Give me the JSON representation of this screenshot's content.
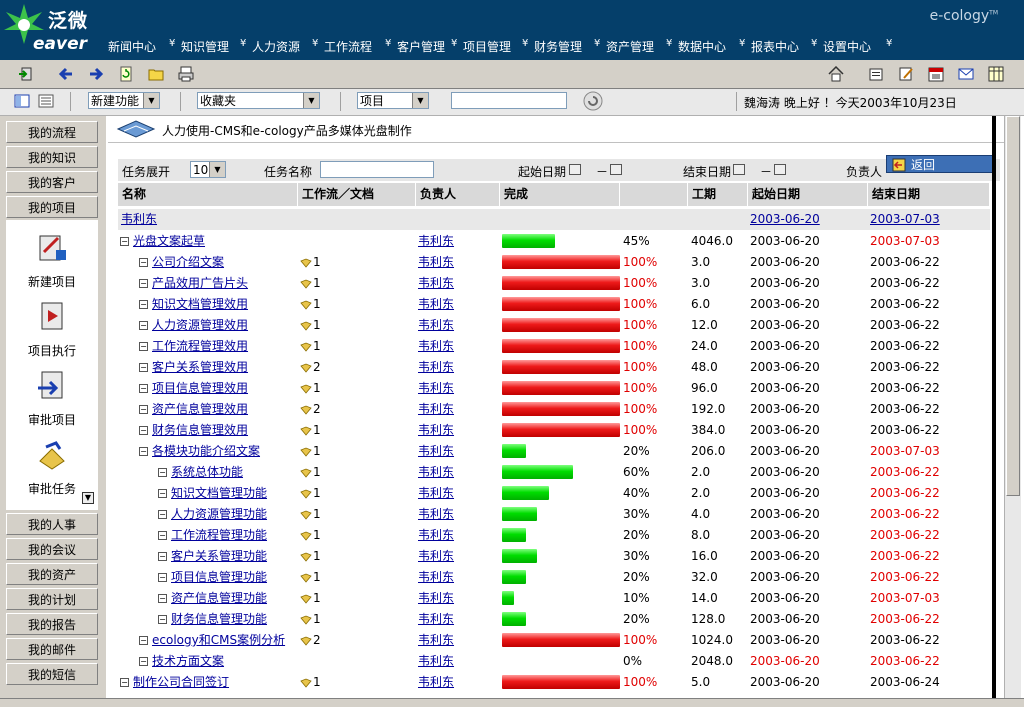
{
  "brand": {
    "logo_cn": "泛微",
    "logo_en": "eaver",
    "product": "e-cology",
    "tm": "TM"
  },
  "nav": [
    "新闻中心",
    "知识管理",
    "人力资源",
    "工作流程",
    "客户管理",
    "项目管理",
    "财务管理",
    "资产管理",
    "数据中心",
    "报表中心",
    "设置中心"
  ],
  "quickbar": {
    "new_function": "新建功能",
    "favorites": "收藏夹",
    "scope": "项目",
    "search_value": "",
    "greeting": "魏海涛 晚上好 ！今天2003年10月23日"
  },
  "sidebar": {
    "top": [
      "我的流程",
      "我的知识",
      "我的客户",
      "我的项目"
    ],
    "panel": [
      "新建项目",
      "项目执行",
      "审批项目",
      "审批任务"
    ],
    "bottom": [
      "我的人事",
      "我的会议",
      "我的资产",
      "我的计划",
      "我的报告",
      "我的邮件",
      "我的短信"
    ]
  },
  "page": {
    "title": "人力使用-CMS和e-cology产品多媒体光盘制作",
    "filter": {
      "expand_label": "任务展开",
      "expand_value": "10",
      "name_label": "任务名称",
      "start_label": "起始日期",
      "dash": "－",
      "end_label": "结束日期",
      "owner_label": "负责人",
      "return_label": "返回"
    },
    "headers": [
      "名称",
      "工作流／文档",
      "负责人",
      "完成",
      "",
      "工期",
      "起始日期",
      "结束日期"
    ]
  },
  "colors": {
    "nav_bg": "#053f6a",
    "link": "#00009c",
    "overdue": "#e00000",
    "bar_done": "#ee1a1a",
    "bar_progress": "#00dd00"
  },
  "group_row": {
    "name": "韦利东",
    "start": "2003-06-20",
    "end": "2003-07-03"
  },
  "rows": [
    {
      "level": 0,
      "name": "光盘文案起草",
      "docs": "",
      "owner": "韦利东",
      "pct": 45,
      "pct_label": "45%",
      "duration": "4046.0",
      "start": "2003-06-20",
      "end": "2003-07-03",
      "end_red": true,
      "start_red": false
    },
    {
      "level": 1,
      "name": "公司介绍文案",
      "docs": "1",
      "owner": "韦利东",
      "pct": 100,
      "pct_label": "100%",
      "duration": "3.0",
      "start": "2003-06-20",
      "end": "2003-06-22",
      "end_red": false,
      "start_red": false
    },
    {
      "level": 1,
      "name": "产品效用广告片头",
      "docs": "1",
      "owner": "韦利东",
      "pct": 100,
      "pct_label": "100%",
      "duration": "3.0",
      "start": "2003-06-20",
      "end": "2003-06-22",
      "end_red": false,
      "start_red": false
    },
    {
      "level": 1,
      "name": "知识文档管理效用",
      "docs": "1",
      "owner": "韦利东",
      "pct": 100,
      "pct_label": "100%",
      "duration": "6.0",
      "start": "2003-06-20",
      "end": "2003-06-22",
      "end_red": false,
      "start_red": false
    },
    {
      "level": 1,
      "name": "人力资源管理效用",
      "docs": "1",
      "owner": "韦利东",
      "pct": 100,
      "pct_label": "100%",
      "duration": "12.0",
      "start": "2003-06-20",
      "end": "2003-06-22",
      "end_red": false,
      "start_red": false
    },
    {
      "level": 1,
      "name": "工作流程管理效用",
      "docs": "1",
      "owner": "韦利东",
      "pct": 100,
      "pct_label": "100%",
      "duration": "24.0",
      "start": "2003-06-20",
      "end": "2003-06-22",
      "end_red": false,
      "start_red": false
    },
    {
      "level": 1,
      "name": "客户关系管理效用",
      "docs": "2",
      "owner": "韦利东",
      "pct": 100,
      "pct_label": "100%",
      "duration": "48.0",
      "start": "2003-06-20",
      "end": "2003-06-22",
      "end_red": false,
      "start_red": false
    },
    {
      "level": 1,
      "name": "项目信息管理效用",
      "docs": "1",
      "owner": "韦利东",
      "pct": 100,
      "pct_label": "100%",
      "duration": "96.0",
      "start": "2003-06-20",
      "end": "2003-06-22",
      "end_red": false,
      "start_red": false
    },
    {
      "level": 1,
      "name": "资产信息管理效用",
      "docs": "2",
      "owner": "韦利东",
      "pct": 100,
      "pct_label": "100%",
      "duration": "192.0",
      "start": "2003-06-20",
      "end": "2003-06-22",
      "end_red": false,
      "start_red": false
    },
    {
      "level": 1,
      "name": "财务信息管理效用",
      "docs": "1",
      "owner": "韦利东",
      "pct": 100,
      "pct_label": "100%",
      "duration": "384.0",
      "start": "2003-06-20",
      "end": "2003-06-22",
      "end_red": false,
      "start_red": false
    },
    {
      "level": 1,
      "name": "各模块功能介绍文案",
      "docs": "1",
      "owner": "韦利东",
      "pct": 20,
      "pct_label": "20%",
      "duration": "206.0",
      "start": "2003-06-20",
      "end": "2003-07-03",
      "end_red": true,
      "start_red": false
    },
    {
      "level": 2,
      "name": "系统总体功能",
      "docs": "1",
      "owner": "韦利东",
      "pct": 60,
      "pct_label": "60%",
      "duration": "2.0",
      "start": "2003-06-20",
      "end": "2003-06-22",
      "end_red": true,
      "start_red": false
    },
    {
      "level": 2,
      "name": "知识文档管理功能",
      "docs": "1",
      "owner": "韦利东",
      "pct": 40,
      "pct_label": "40%",
      "duration": "2.0",
      "start": "2003-06-20",
      "end": "2003-06-22",
      "end_red": true,
      "start_red": false
    },
    {
      "level": 2,
      "name": "人力资源管理功能",
      "docs": "1",
      "owner": "韦利东",
      "pct": 30,
      "pct_label": "30%",
      "duration": "4.0",
      "start": "2003-06-20",
      "end": "2003-06-22",
      "end_red": true,
      "start_red": false
    },
    {
      "level": 2,
      "name": "工作流程管理功能",
      "docs": "1",
      "owner": "韦利东",
      "pct": 20,
      "pct_label": "20%",
      "duration": "8.0",
      "start": "2003-06-20",
      "end": "2003-06-22",
      "end_red": true,
      "start_red": false
    },
    {
      "level": 2,
      "name": "客户关系管理功能",
      "docs": "1",
      "owner": "韦利东",
      "pct": 30,
      "pct_label": "30%",
      "duration": "16.0",
      "start": "2003-06-20",
      "end": "2003-06-22",
      "end_red": true,
      "start_red": false
    },
    {
      "level": 2,
      "name": "项目信息管理功能",
      "docs": "1",
      "owner": "韦利东",
      "pct": 20,
      "pct_label": "20%",
      "duration": "32.0",
      "start": "2003-06-20",
      "end": "2003-06-22",
      "end_red": true,
      "start_red": false
    },
    {
      "level": 2,
      "name": "资产信息管理功能",
      "docs": "1",
      "owner": "韦利东",
      "pct": 10,
      "pct_label": "10%",
      "duration": "14.0",
      "start": "2003-06-20",
      "end": "2003-07-03",
      "end_red": true,
      "start_red": false
    },
    {
      "level": 2,
      "name": "财务信息管理功能",
      "docs": "1",
      "owner": "韦利东",
      "pct": 20,
      "pct_label": "20%",
      "duration": "128.0",
      "start": "2003-06-20",
      "end": "2003-06-22",
      "end_red": true,
      "start_red": false
    },
    {
      "level": 1,
      "name": "ecology和CMS案例分析",
      "docs": "2",
      "owner": "韦利东",
      "pct": 100,
      "pct_label": "100%",
      "duration": "1024.0",
      "start": "2003-06-20",
      "end": "2003-06-22",
      "end_red": false,
      "start_red": false
    },
    {
      "level": 1,
      "name": "技术方面文案",
      "docs": "",
      "owner": "韦利东",
      "pct": 0,
      "pct_label": "0%",
      "duration": "2048.0",
      "start": "2003-06-20",
      "end": "2003-06-22",
      "end_red": true,
      "start_red": true
    },
    {
      "level": 0,
      "name": "制作公司合同签订",
      "docs": "1",
      "owner": "韦利东",
      "pct": 100,
      "pct_label": "100%",
      "duration": "5.0",
      "start": "2003-06-20",
      "end": "2003-06-24",
      "end_red": false,
      "start_red": false
    }
  ]
}
